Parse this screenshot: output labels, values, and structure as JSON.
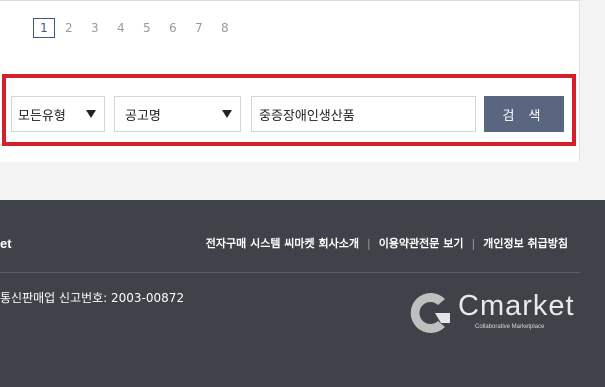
{
  "pagination": {
    "pages": [
      "1",
      "2",
      "3",
      "4",
      "5",
      "6",
      "7",
      "8"
    ],
    "current": "1"
  },
  "search": {
    "type_select": "모든유형",
    "field_select": "공고명",
    "keyword_value": "중증장애인생산품",
    "button_label": "검 색"
  },
  "footer": {
    "brand_fragment": "et",
    "links": [
      "전자구매 시스템 씨마켓 회사소개",
      "이용약관전문 보기",
      "개인정보 취급방침"
    ],
    "registration": "통신판매업 신고번호: 2003-00872",
    "logo_text": "Cmarket",
    "logo_tagline": "Collaborative Marketplace"
  },
  "colors": {
    "highlight_border": "#d4202c",
    "search_button": "#5a6580",
    "footer_bg": "#3f4248",
    "active_page": "#3b5b86"
  }
}
